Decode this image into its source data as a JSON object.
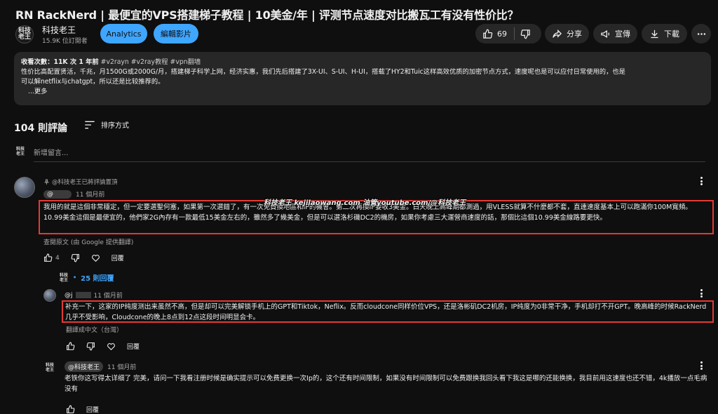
{
  "video": {
    "title": "RN RackNerd | 最便宜的VPS搭建梯子教程 | 10美金/年 | 评测节点速度对比搬瓦工有没有性价比？"
  },
  "channel": {
    "logo_text": "科技老王",
    "name": "科技老王",
    "subscribers": "15.9K 位訂閱者"
  },
  "toolbar": {
    "analytics_label": "Analytics",
    "edit_label": "編輯影片",
    "like_count": "69",
    "share_label": "分享",
    "promote_label": "宣傳",
    "download_label": "下載"
  },
  "description": {
    "meta": "收看次數：11K 次  1 年前",
    "tags": "#v2rayn #v2ray教程 #vpn翻墙",
    "line1": "性价比高配置贤活，千兆，月1500G或2000G/月，搭建梯子科学上网，经济实惠，我们先后搭建了3X-UI、S-UI、H-UI，搭载了HY2和Tuic这样高效优质的加密节点方式，速度呢也是可以应付日常使用的，也是",
    "line2": "可以解netflix与chatgpt，所以还是比较推荐的。",
    "more": "...更多"
  },
  "comments_header": {
    "count": "104 則評論",
    "sort_label": "排序方式",
    "add_placeholder": "新增留言..."
  },
  "watermark": "科技老王 kejilaowang.com 油管youtube.com/@科技老王",
  "comments": [
    {
      "pinned_text": "@科技老王已將評論置頂",
      "author": "@",
      "time": "11 個月前",
      "text": "我用的就是這個非常穩定，但一定要選聖何塞，如果第一次選錯了，有一次免費換地區和IP的機會。第二次再換IP要收3美金。白天晚上高峰期都測過，用VLESS就算不什麼都不套，直連速度基本上可以跑滿你100M寬頻。 10.99美金這個是最便宜的，他們家2G內存有一款最低15美金左右的，雖然多了幾美金，但是可以選洛杉磯DC2的機房，如果你考慮三大運營商速度的話，那個比這個10.99美金線路要更快。",
      "translate": "查閱原文 (由 Google 提供翻譯)",
      "likes": "4",
      "reply_label": "回覆",
      "replies_label": "25 則回覆"
    },
    {
      "author": "@j",
      "time": "11 個月前",
      "text": "补充一下，这家的IP纯度测出来虽然不高，但是却可以完美解锁手机上的GPT和Tiktok，Neflix。反而cloudcone同样价位VPS，还是洛彬矶DC2机房，IP纯度为0非常干净，手机却打不开GPT。晚高峰的时候RackNerd几乎不受影响，Cloudcone的晚上8点到12点这段时间明显会卡。",
      "translate": "翻譯成中文（台灣）",
      "reply_label": "回覆"
    },
    {
      "author": "@科技老王",
      "time": "11 個月前",
      "text": "老铁你这写得太详细了 完美，请问一下我看注册时候是确实提示可以免费更换一次Ip的，这个还有时间限制，如果没有时间限制可以免费跟换我回头看下我这是哪的还能换换，我目前用这速度也还不错，4k播放一点毛病没有",
      "reply_label": "回覆"
    }
  ],
  "colors": {
    "background": "#0f0f0f",
    "accent": "#3ea6ff",
    "highlight": "#e53935",
    "surface": "#272727"
  }
}
